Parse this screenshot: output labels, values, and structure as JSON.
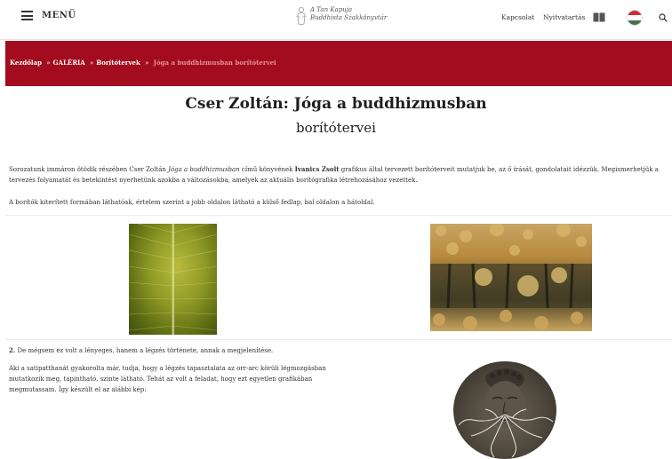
{
  "header": {
    "menu_label": "MENÜ",
    "logo_line1": "A Tan Kapuja",
    "logo_line2": "Buddhista Szakkönyvtár",
    "nav": [
      "Kapcsolat",
      "Nyitvatartás"
    ]
  },
  "breadcrumb": {
    "items": [
      "Kezdőlap",
      "GALÉRIA",
      "Borítótervek"
    ],
    "separator": "»",
    "current": "Jóga a buddhizmusban borítótervei"
  },
  "article": {
    "title": "Cser Zoltán: Jóga a buddhizmusban",
    "subtitle": "borítótervei",
    "p1_a": "Sorozatunk immáron ötödik részében Cser Zoltán ",
    "p1_book": "Jóga a buddhizmusban",
    "p1_b": " című könyvének ",
    "p1_author": "Ivanics Zsolt",
    "p1_c": " grafikus által tervezett borítóterveit mutatjuk be, az ő írását, gondolatait idézzük. Megismerhetjük a tervezés folyamatát és betekintést nyerhetünk azokba a változásokba, amelyek az aktuális borítógrafika létrehozásához vezettek.",
    "p2": "A borítók kiterített formában láthatóak, értelem szerint a jobb oldalon látható a külső fedlap, bal oldalon a hátoldal.",
    "p3_num": "2.",
    "p3": " De mégsem ez volt a lényeges, hanem a légzés története, annak a megjelenítése.",
    "p4": "Aki a satipatthanát gyakorolta már, tudja, hogy a légzés tapasztalata az orr-arc körüli légmozgásban mutatkozik meg, tapintható, szinte látható. Tehát az volt a feladat, hogy ezt egyetlen grafikában megmutassam. Így készült el az alábbi kép:"
  },
  "icons": {
    "menu": "hamburger-icon",
    "book": "book-icon",
    "flag": "hungarian-flag-icon",
    "search": "search-icon"
  },
  "colors": {
    "banner": "#a30b1e",
    "breadcrumb_current": "#e8929a"
  }
}
